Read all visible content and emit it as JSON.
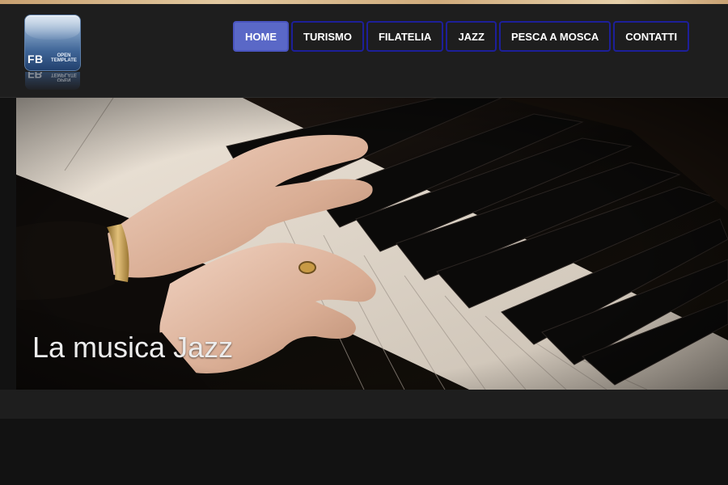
{
  "logo": {
    "initials": "FB",
    "subtitle_line1": "OPEN",
    "subtitle_line2": "TEMPLATE"
  },
  "nav": {
    "items": [
      {
        "label": "HOME",
        "active": true
      },
      {
        "label": "TURISMO",
        "active": false
      },
      {
        "label": "FILATELIA",
        "active": false
      },
      {
        "label": "JAZZ",
        "active": false
      },
      {
        "label": "PESCA A MOSCA",
        "active": false
      },
      {
        "label": "CONTATTI",
        "active": false
      }
    ]
  },
  "hero": {
    "image_subject": "hands-playing-piano",
    "caption": "La musica Jazz"
  },
  "colors": {
    "header_bg": "#1e1e1e",
    "page_bg": "#121212",
    "nav_active": "#5a68c7",
    "nav_border": "#1d1f9a"
  }
}
